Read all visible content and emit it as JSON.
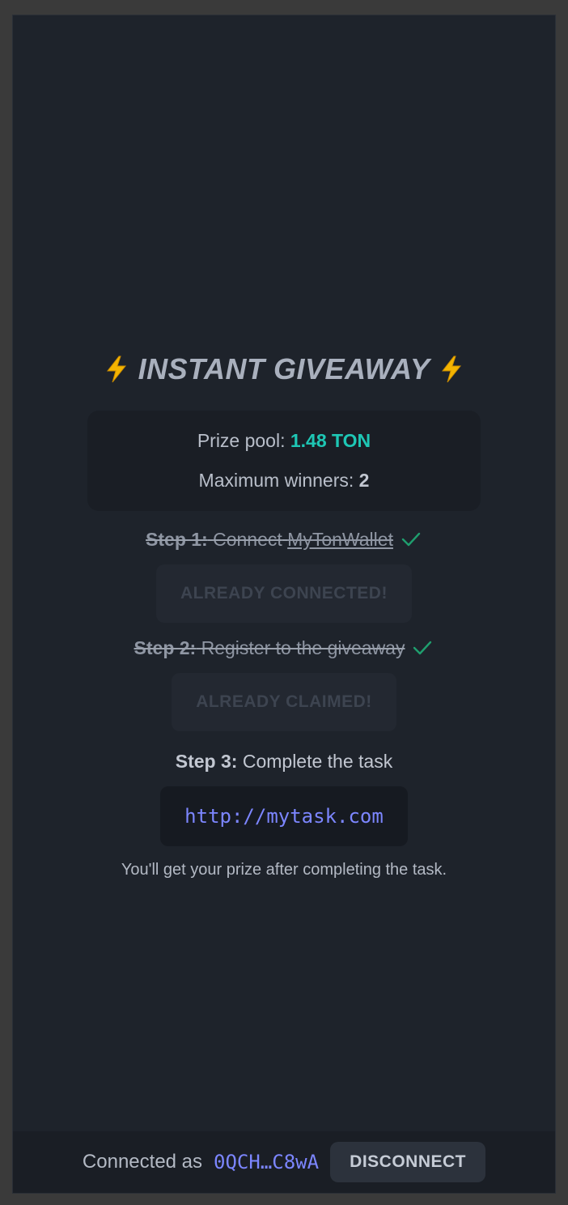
{
  "header": {
    "title": "INSTANT GIVEAWAY",
    "title_icon": "lightning-bolt-emoji"
  },
  "prize": {
    "pool_label": "Prize pool:",
    "pool_value": "1.48 TON",
    "winners_label": "Maximum winners:",
    "winners_value": "2"
  },
  "steps": [
    {
      "label": "Step 1:",
      "text_prefix": "Connect",
      "link_text": "MyTonWallet",
      "done": true,
      "button_label": "ALREADY CONNECTED!",
      "button_disabled": true
    },
    {
      "label": "Step 2:",
      "text": "Register to the giveaway",
      "done": true,
      "button_label": "ALREADY CLAIMED!",
      "button_disabled": true
    },
    {
      "label": "Step 3:",
      "text": "Complete the task",
      "done": false,
      "link": "http://mytask.com"
    }
  ],
  "note": "You'll get your prize after completing the task.",
  "footer": {
    "connected_label": "Connected as",
    "address": "0QCH…C8wA",
    "disconnect_label": "DISCONNECT"
  },
  "colors": {
    "accent_teal": "#1ec7b5",
    "link_blue": "#7c86ff",
    "check_green": "#1f9e6e",
    "background": "#1e232b"
  }
}
